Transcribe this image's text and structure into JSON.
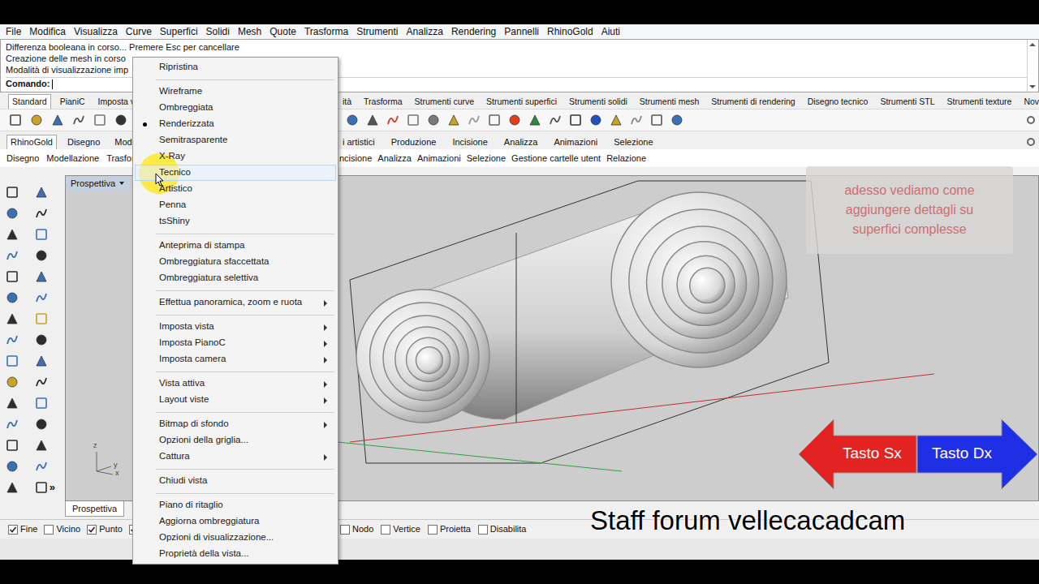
{
  "menubar": [
    "File",
    "Modifica",
    "Visualizza",
    "Curve",
    "Superfici",
    "Solidi",
    "Mesh",
    "Quote",
    "Trasforma",
    "Strumenti",
    "Analizza",
    "Rendering",
    "Pannelli",
    "RhinoGold",
    "Aiuti"
  ],
  "command": {
    "history": [
      "Differenza booleana in corso... Premere Esc per cancellare",
      "Creazione delle mesh in corso",
      "Modalità di visualizzazione imp"
    ],
    "prompt": "Comando:"
  },
  "toolbar_tabs": {
    "left": [
      {
        "label": "Standard",
        "selected": true
      },
      {
        "label": "PianiC",
        "selected": false
      },
      {
        "label": "Imposta v",
        "selected": false
      }
    ],
    "right": [
      {
        "label": "ità",
        "selected": false
      },
      {
        "label": "Trasforma",
        "selected": false
      },
      {
        "label": "Strumenti curve",
        "selected": false
      },
      {
        "label": "Strumenti superfici",
        "selected": false
      },
      {
        "label": "Strumenti solidi",
        "selected": false
      },
      {
        "label": "Strumenti mesh",
        "selected": false
      },
      {
        "label": "Strumenti di rendering",
        "selected": false
      },
      {
        "label": "Disegno tecnico",
        "selected": false
      },
      {
        "label": "Strumenti STL",
        "selected": false
      },
      {
        "label": "Strumenti texture",
        "selected": false
      },
      {
        "label": "Nov",
        "selected": false
      }
    ]
  },
  "rhinogold_tabs": {
    "left": [
      {
        "label": "RhinoGold",
        "selected": true
      },
      {
        "label": "Disegno",
        "selected": false
      },
      {
        "label": "Model",
        "selected": false
      }
    ],
    "right": [
      {
        "label": "i artistici",
        "selected": false
      },
      {
        "label": "Produzione",
        "selected": false
      },
      {
        "label": "Incisione",
        "selected": false
      },
      {
        "label": "Analizza",
        "selected": false
      },
      {
        "label": "Animazioni",
        "selected": false
      },
      {
        "label": "Selezione",
        "selected": false
      }
    ]
  },
  "rhinogold_groups": {
    "left": [
      "Disegno",
      "Modellazione",
      "Trasfor"
    ],
    "right": [
      "ncisione",
      "Analizza",
      "Animazioni",
      "Selezione",
      "Gestione cartelle utent",
      "Relazione"
    ]
  },
  "toolbox": {
    "more": "»"
  },
  "viewport": {
    "title": "Prospettiva",
    "tab": "Prospettiva",
    "axes": [
      "z",
      "y",
      "x"
    ]
  },
  "context_menu": {
    "groups": [
      [
        {
          "label": "Ripristina",
          "checked": false,
          "hovered": false,
          "submenu": false
        }
      ],
      [
        {
          "label": "Wireframe",
          "checked": false,
          "hovered": false,
          "submenu": false
        },
        {
          "label": "Ombreggiata",
          "checked": false,
          "hovered": false,
          "submenu": false
        },
        {
          "label": "Renderizzata",
          "checked": true,
          "hovered": false,
          "submenu": false
        },
        {
          "label": "Semitrasparente",
          "checked": false,
          "hovered": false,
          "submenu": false
        },
        {
          "label": "X-Ray",
          "checked": false,
          "hovered": false,
          "submenu": false
        },
        {
          "label": "Tecnico",
          "checked": false,
          "hovered": true,
          "submenu": false
        },
        {
          "label": "Artistico",
          "checked": false,
          "hovered": false,
          "submenu": false
        },
        {
          "label": "Penna",
          "checked": false,
          "hovered": false,
          "submenu": false
        },
        {
          "label": "tsShiny",
          "checked": false,
          "hovered": false,
          "submenu": false
        }
      ],
      [
        {
          "label": "Anteprima di stampa",
          "checked": false,
          "hovered": false,
          "submenu": false
        },
        {
          "label": "Ombreggiatura sfaccettata",
          "checked": false,
          "hovered": false,
          "submenu": false
        },
        {
          "label": "Ombreggiatura selettiva",
          "checked": false,
          "hovered": false,
          "submenu": false
        }
      ],
      [
        {
          "label": "Effettua panoramica, zoom e ruota",
          "checked": false,
          "hovered": false,
          "submenu": true
        }
      ],
      [
        {
          "label": "Imposta vista",
          "checked": false,
          "hovered": false,
          "submenu": true
        },
        {
          "label": "Imposta PianoC",
          "checked": false,
          "hovered": false,
          "submenu": true
        },
        {
          "label": "Imposta camera",
          "checked": false,
          "hovered": false,
          "submenu": true
        }
      ],
      [
        {
          "label": "Vista attiva",
          "checked": false,
          "hovered": false,
          "submenu": true
        },
        {
          "label": "Layout viste",
          "checked": false,
          "hovered": false,
          "submenu": true
        }
      ],
      [
        {
          "label": "Bitmap di sfondo",
          "checked": false,
          "hovered": false,
          "submenu": true
        },
        {
          "label": "Opzioni della griglia...",
          "checked": false,
          "hovered": false,
          "submenu": false
        },
        {
          "label": "Cattura",
          "checked": false,
          "hovered": false,
          "submenu": true
        }
      ],
      [
        {
          "label": "Chiudi vista",
          "checked": false,
          "hovered": false,
          "submenu": false
        }
      ],
      [
        {
          "label": "Piano di ritaglio",
          "checked": false,
          "hovered": false,
          "submenu": false
        },
        {
          "label": "Aggiorna ombreggiatura",
          "checked": false,
          "hovered": false,
          "submenu": false
        },
        {
          "label": "Opzioni di visualizzazione...",
          "checked": false,
          "hovered": false,
          "submenu": false
        },
        {
          "label": "Proprietà della vista...",
          "checked": false,
          "hovered": false,
          "submenu": false
        }
      ]
    ]
  },
  "osnaps": {
    "left": [
      {
        "label": "Fine",
        "checked": true
      },
      {
        "label": "Vicino",
        "checked": false
      },
      {
        "label": "Punto",
        "checked": true
      },
      {
        "label": "",
        "checked": true
      }
    ],
    "right": [
      {
        "label": "Nodo",
        "checked": false
      },
      {
        "label": "Vertice",
        "checked": false
      },
      {
        "label": "Proietta",
        "checked": false
      },
      {
        "label": "Disabilita",
        "checked": false
      }
    ]
  },
  "overlay": {
    "note": [
      "adesso vediamo come",
      "aggiungere dettagli su",
      "superfici complesse"
    ],
    "buttons": [
      {
        "label": "Tasto Sx",
        "color": "#e32222"
      },
      {
        "label": "Tasto Dx",
        "color": "#1f2fe6"
      }
    ],
    "watermark": "Staff forum vellecacadcam"
  }
}
